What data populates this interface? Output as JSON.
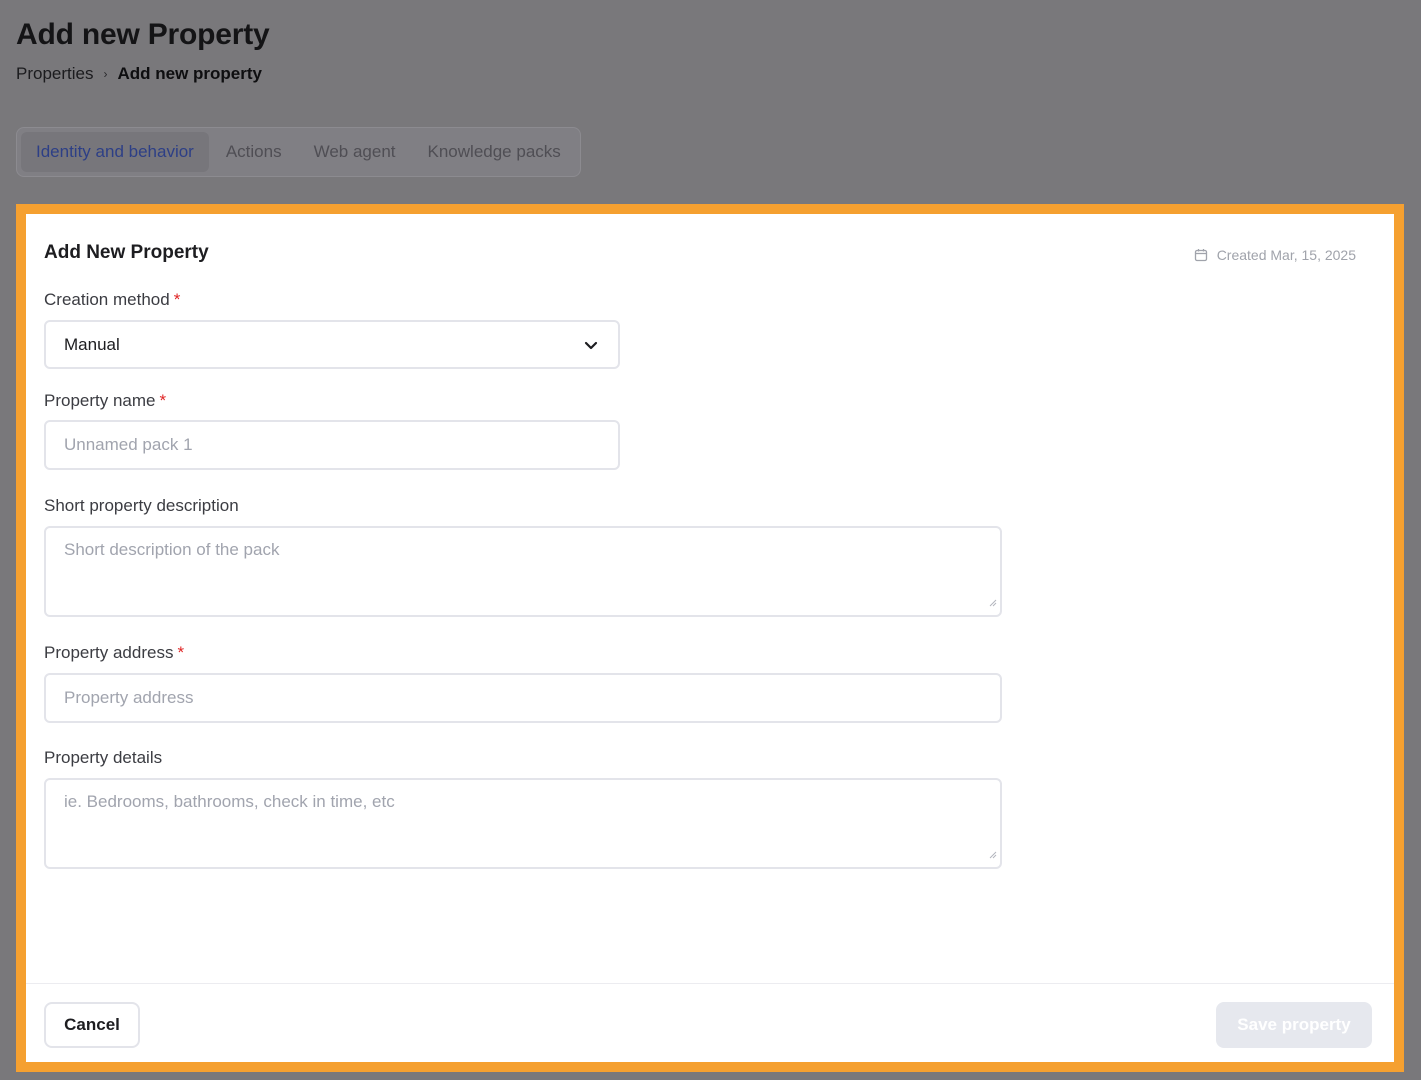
{
  "page": {
    "title": "Add new Property",
    "breadcrumb": {
      "root": "Properties",
      "separator": "›",
      "current": "Add new property"
    }
  },
  "tabs": [
    {
      "label": "Identity and behavior",
      "active": true
    },
    {
      "label": "Actions",
      "active": false
    },
    {
      "label": "Web agent",
      "active": false
    },
    {
      "label": "Knowledge packs",
      "active": false
    }
  ],
  "card": {
    "title": "Add New Property",
    "created_label": "Created Mar, 15, 2025",
    "created_icon": "calendar-icon"
  },
  "form": {
    "creation_method": {
      "label": "Creation method",
      "required": "*",
      "value": "Manual"
    },
    "property_name": {
      "label": "Property name",
      "required": "*",
      "placeholder": "Unnamed pack 1"
    },
    "short_description": {
      "label": "Short property description",
      "placeholder": "Short description of the pack"
    },
    "property_address": {
      "label": "Property address",
      "required": "*",
      "placeholder": "Property address"
    },
    "property_details": {
      "label": "Property details",
      "placeholder": "ie. Bedrooms, bathrooms, check in time, etc"
    }
  },
  "footer": {
    "cancel_label": "Cancel",
    "save_label": "Save property"
  },
  "colors": {
    "overlay": "#79787b",
    "highlight_frame": "#f5a030",
    "active_tab": "#2d3f86",
    "required": "#e02424",
    "save_disabled_bg": "#e6e8ee"
  }
}
